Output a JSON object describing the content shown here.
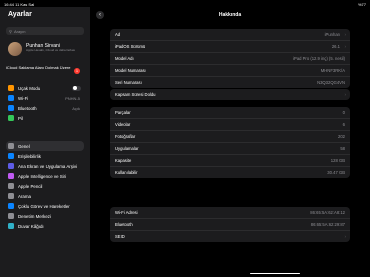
{
  "status": {
    "time": "16:44",
    "date": "11 Kas Sal",
    "battery": "%77"
  },
  "sidebar": {
    "title": "Ayarlar",
    "search_placeholder": "Arayın",
    "profile": {
      "name": "Punhan Sirvani",
      "sub": "Apple Hesabı, iCloud ve daha fazlası"
    },
    "icloud": {
      "label": "iCloud Saklama Alanı Dolmak Üzere",
      "badge": "1"
    },
    "groups": [
      [
        {
          "label": "Uçak Modu",
          "icon_color": "#ff9500",
          "toggle": true,
          "value": ""
        },
        {
          "label": "Wi-Fi",
          "icon_color": "#0a84ff",
          "value": "PNHN-5"
        },
        {
          "label": "Bluetooth",
          "icon_color": "#0a84ff",
          "value": "Açık"
        },
        {
          "label": "Pil",
          "icon_color": "#34c759",
          "value": ""
        }
      ],
      [
        {
          "label": "Genel",
          "icon_color": "#8e8e93",
          "value": "",
          "selected": true
        },
        {
          "label": "Erişilebilirlik",
          "icon_color": "#0a84ff",
          "value": ""
        },
        {
          "label": "Ana Ekran ve Uygulama Arşivi",
          "icon_color": "#5e5ce6",
          "value": ""
        },
        {
          "label": "Apple Intelligence ve Siri",
          "icon_color": "#bf5af2",
          "value": ""
        },
        {
          "label": "Apple Pencil",
          "icon_color": "#8e8e93",
          "value": ""
        },
        {
          "label": "Arama",
          "icon_color": "#8e8e93",
          "value": ""
        },
        {
          "label": "Çoklu Görev ve Hareketler",
          "icon_color": "#0a84ff",
          "value": ""
        },
        {
          "label": "Denetim Merkezi",
          "icon_color": "#8e8e93",
          "value": ""
        },
        {
          "label": "Duvar Kâğıdı",
          "icon_color": "#30b0c7",
          "value": ""
        }
      ]
    ]
  },
  "main": {
    "title": "Hakkında",
    "cards": [
      [
        {
          "label": "Ad",
          "value": "iPunhan",
          "chevron": true
        },
        {
          "label": "iPadOS Sürümü",
          "value": "26.1",
          "chevron": true
        },
        {
          "label": "Model Adı",
          "value": "iPad Pro (12.9 inç) (5. nesil)",
          "chevron": false
        },
        {
          "label": "Model Numarası",
          "value": "MHNF3RK/A",
          "chevron": false
        },
        {
          "label": "Seri Numarası",
          "value": "N3Q32QG4VN",
          "chevron": false
        }
      ],
      [
        {
          "label": "Kapsam Süresi Doldu",
          "value": "",
          "chevron": true
        }
      ],
      [
        {
          "label": "Parçalar",
          "value": "0",
          "chevron": false
        },
        {
          "label": "Videolar",
          "value": "6",
          "chevron": false
        },
        {
          "label": "Fotoğraflar",
          "value": "202",
          "chevron": false
        },
        {
          "label": "Uygulamalar",
          "value": "58",
          "chevron": false
        },
        {
          "label": "Kapasite",
          "value": "128 GB",
          "chevron": false
        },
        {
          "label": "Kullanılabilir",
          "value": "30.47 GB",
          "chevron": false
        }
      ],
      [
        {
          "label": "Wi-Fi Adresi",
          "value": "86:65:5A:62:A8:12",
          "chevron": false
        },
        {
          "label": "Bluetooth",
          "value": "86:65:5A:62:29:87",
          "chevron": false
        },
        {
          "label": "SEID",
          "value": "",
          "chevron": true
        }
      ]
    ]
  }
}
